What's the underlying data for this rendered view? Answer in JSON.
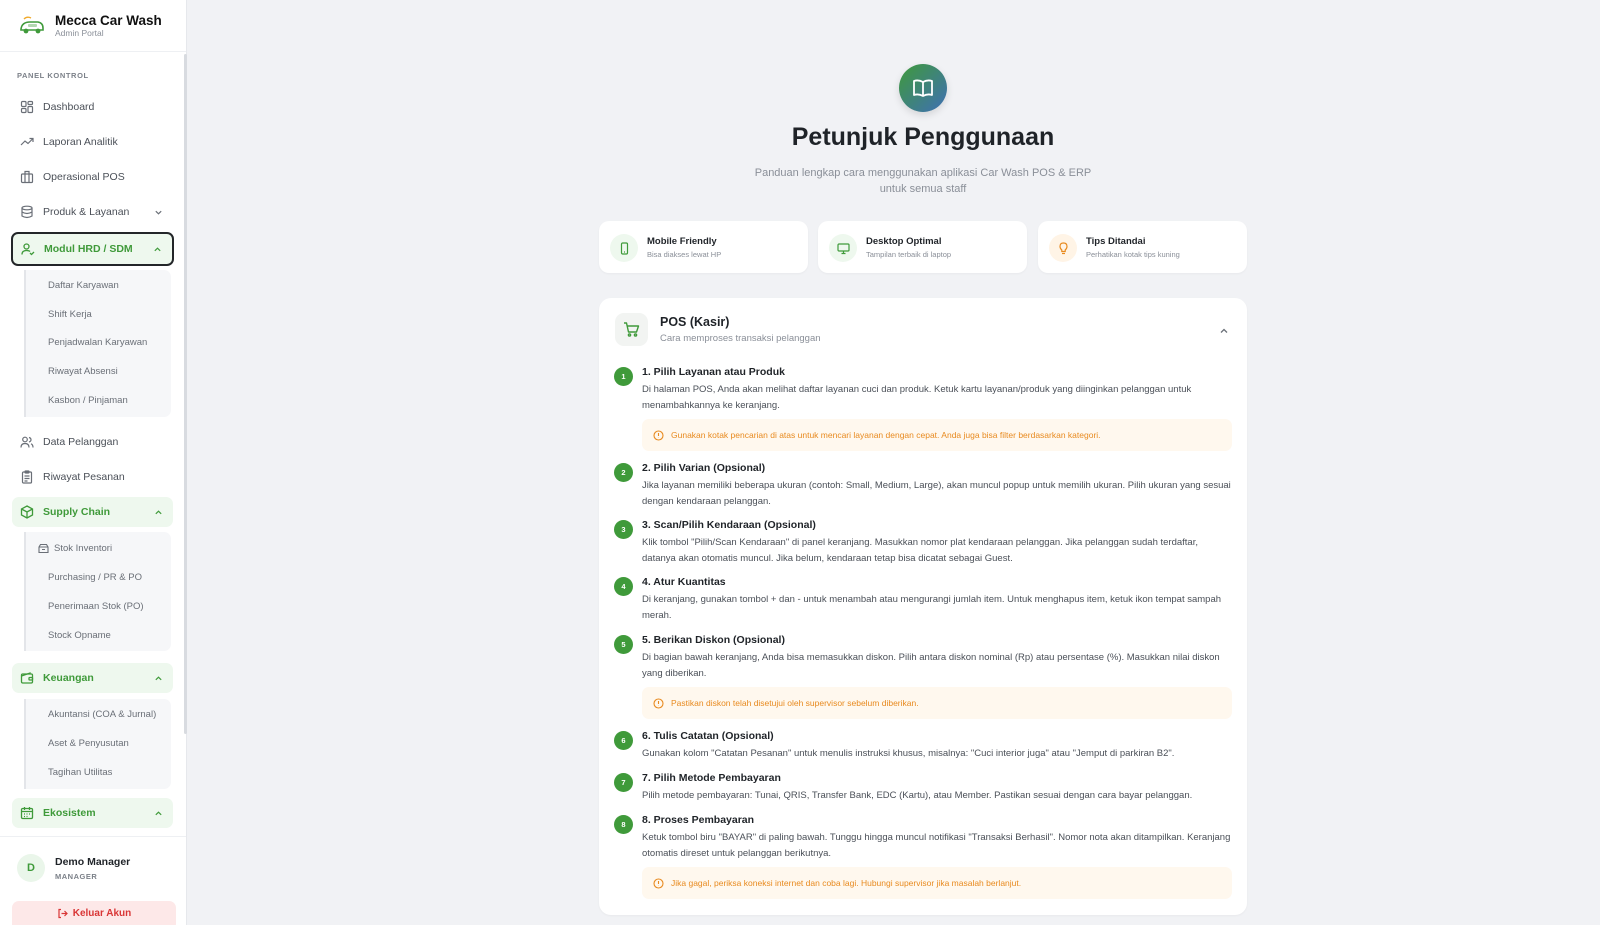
{
  "brand": {
    "title": "Mecca Car Wash",
    "subtitle": "Admin Portal"
  },
  "sidebar": {
    "section_label": "PANEL KONTROL",
    "items": {
      "dashboard": "Dashboard",
      "laporan": "Laporan Analitik",
      "pos": "Operasional POS",
      "produk": "Produk & Layanan",
      "hrd": "Modul HRD / SDM",
      "pelanggan": "Data Pelanggan",
      "riwayat": "Riwayat Pesanan",
      "supply": "Supply Chain",
      "keuangan": "Keuangan",
      "ekosistem": "Ekosistem"
    },
    "hrd_sub": [
      "Daftar Karyawan",
      "Shift Kerja",
      "Penjadwalan Karyawan",
      "Riwayat Absensi",
      "Kasbon / Pinjaman"
    ],
    "supply_sub": [
      "Stok Inventori",
      "Purchasing / PR & PO",
      "Penerimaan Stok (PO)",
      "Stock Opname"
    ],
    "keuangan_sub": [
      "Akuntansi (COA & Jurnal)",
      "Aset & Penyusutan",
      "Tagihan Utilitas"
    ]
  },
  "user": {
    "initial": "D",
    "name": "Demo Manager",
    "role": "MANAGER",
    "logout_label": "Keluar Akun"
  },
  "page": {
    "title": "Petunjuk Penggunaan",
    "subtitle": "Panduan lengkap cara menggunakan aplikasi Car Wash POS & ERP untuk semua staff"
  },
  "features": [
    {
      "title": "Mobile Friendly",
      "desc": "Bisa diakses lewat HP"
    },
    {
      "title": "Desktop Optimal",
      "desc": "Tampilan terbaik di laptop"
    },
    {
      "title": "Tips Ditandai",
      "desc": "Perhatikan kotak tips kuning"
    }
  ],
  "pos_section": {
    "title": "POS (Kasir)",
    "subtitle": "Cara memproses transaksi pelanggan",
    "steps": [
      {
        "num": "1",
        "title": "1. Pilih Layanan atau Produk",
        "text": "Di halaman POS, Anda akan melihat daftar layanan cuci dan produk. Ketuk kartu layanan/produk yang diinginkan pelanggan untuk menambahkannya ke keranjang.",
        "tip": "Gunakan kotak pencarian di atas untuk mencari layanan dengan cepat. Anda juga bisa filter berdasarkan kategori."
      },
      {
        "num": "2",
        "title": "2. Pilih Varian (Opsional)",
        "text": "Jika layanan memiliki beberapa ukuran (contoh: Small, Medium, Large), akan muncul popup untuk memilih ukuran. Pilih ukuran yang sesuai dengan kendaraan pelanggan."
      },
      {
        "num": "3",
        "title": "3. Scan/Pilih Kendaraan (Opsional)",
        "text": "Klik tombol \"Pilih/Scan Kendaraan\" di panel keranjang. Masukkan nomor plat kendaraan pelanggan. Jika pelanggan sudah terdaftar, datanya akan otomatis muncul. Jika belum, kendaraan tetap bisa dicatat sebagai Guest."
      },
      {
        "num": "4",
        "title": "4. Atur Kuantitas",
        "text": "Di keranjang, gunakan tombol + dan - untuk menambah atau mengurangi jumlah item. Untuk menghapus item, ketuk ikon tempat sampah merah."
      },
      {
        "num": "5",
        "title": "5. Berikan Diskon (Opsional)",
        "text": "Di bagian bawah keranjang, Anda bisa memasukkan diskon. Pilih antara diskon nominal (Rp) atau persentase (%). Masukkan nilai diskon yang diberikan.",
        "tip": "Pastikan diskon telah disetujui oleh supervisor sebelum diberikan."
      },
      {
        "num": "6",
        "title": "6. Tulis Catatan (Opsional)",
        "text": "Gunakan kolom \"Catatan Pesanan\" untuk menulis instruksi khusus, misalnya: \"Cuci interior juga\" atau \"Jemput di parkiran B2\"."
      },
      {
        "num": "7",
        "title": "7. Pilih Metode Pembayaran",
        "text": "Pilih metode pembayaran: Tunai, QRIS, Transfer Bank, EDC (Kartu), atau Member. Pastikan sesuai dengan cara bayar pelanggan."
      },
      {
        "num": "8",
        "title": "8. Proses Pembayaran",
        "text": "Ketuk tombol biru \"BAYAR\" di paling bawah. Tunggu hingga muncul notifikasi \"Transaksi Berhasil\". Nomor nota akan ditampilkan. Keranjang otomatis direset untuk pelanggan berikutnya.",
        "tip": "Jika gagal, periksa koneksi internet dan coba lagi. Hubungi supervisor jika masalah berlanjut."
      }
    ]
  },
  "colors": {
    "accent_green": "#3f9a3a",
    "tip_orange": "#e88a1f",
    "logout_red": "#d93636",
    "background": "#f1f2f5"
  },
  "icons": [
    "app-logo-icon",
    "dashboard-icon",
    "chart-icon",
    "store-icon",
    "database-icon",
    "user-check-icon",
    "users-icon",
    "clipboard-icon",
    "package-icon",
    "wallet-icon",
    "calendar-icon",
    "logout-icon",
    "book-icon",
    "phone-icon",
    "monitor-icon",
    "bulb-icon",
    "cart-icon",
    "info-icon",
    "chevron-down-icon",
    "chevron-up-icon",
    "box-icon"
  ]
}
